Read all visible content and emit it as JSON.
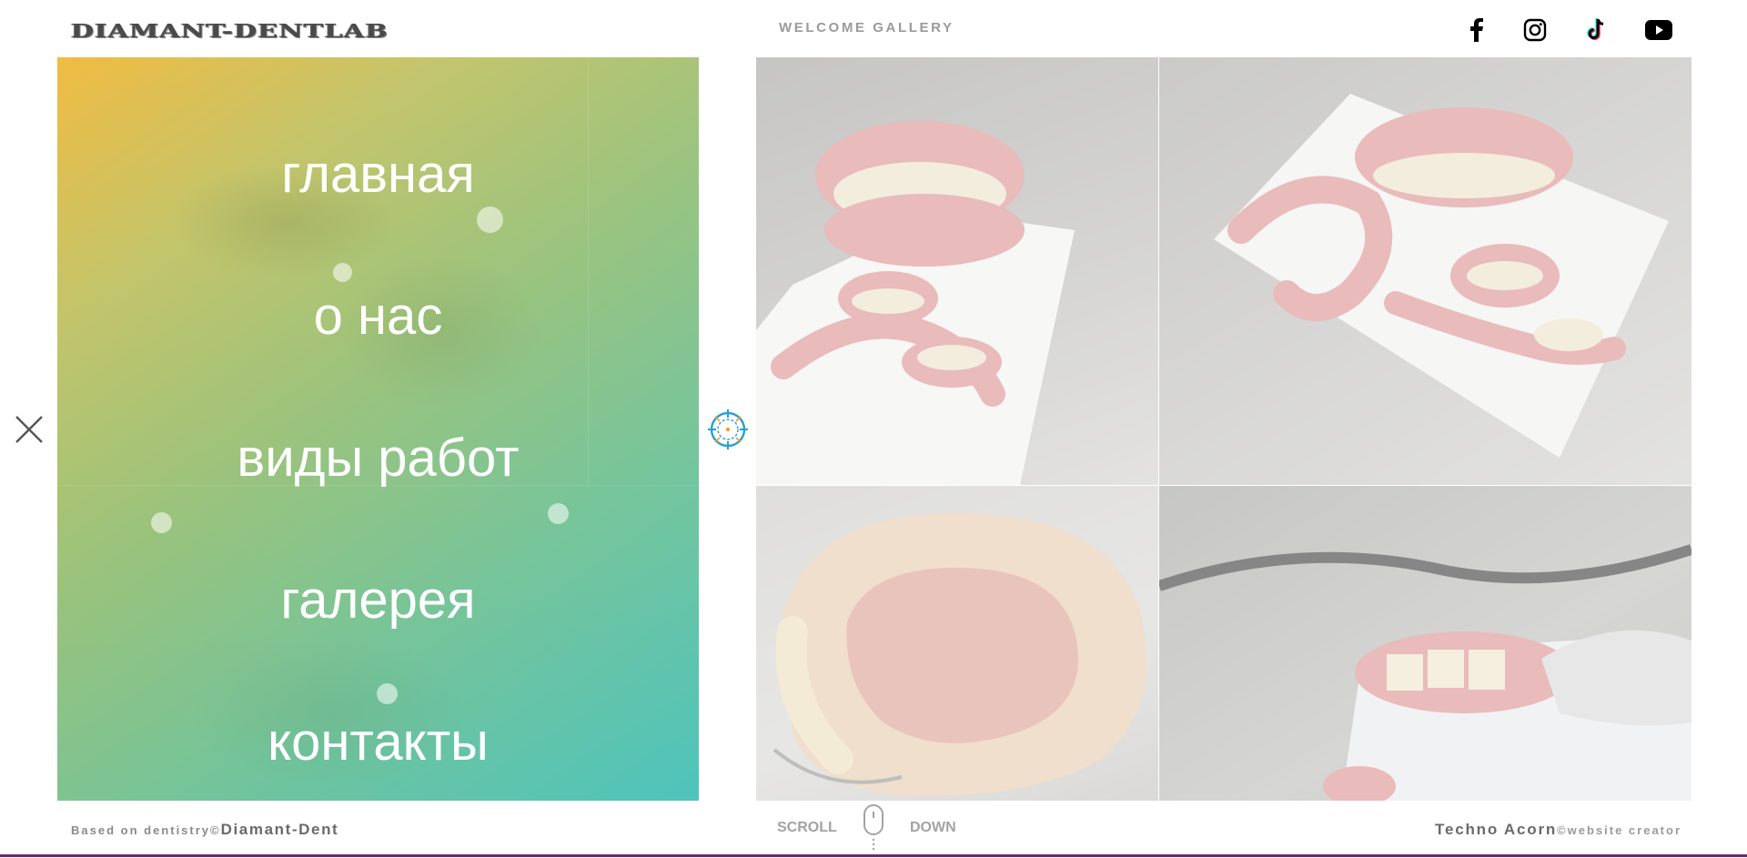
{
  "header": {
    "logo_text": "DIAMANT-DENTLAB",
    "welcome_text": "WELCOME GALLERY",
    "social_icons": [
      "facebook-icon",
      "instagram-icon",
      "tiktok-icon",
      "youtube-icon"
    ]
  },
  "menu": {
    "items": [
      {
        "label": "главная"
      },
      {
        "label": "о нас"
      },
      {
        "label": "виды работ"
      },
      {
        "label": "галерея"
      },
      {
        "label": "контакты"
      }
    ],
    "close_icon": "close-icon"
  },
  "gallery": {
    "tiles": [
      "denture-photo",
      "denture-photo",
      "denture-photo",
      "denture-photo"
    ]
  },
  "footer": {
    "left_prefix": "Based on dentistry©",
    "left_brand": "Diamant-Dent",
    "scroll_left": "SCROLL",
    "scroll_right": "DOWN",
    "right_brand": "Techno Acorn",
    "right_suffix": "©website creator"
  },
  "colors": {
    "gradient_start": "#f0b93b",
    "gradient_end": "#4ec4bc",
    "target_blue": "#2a9fd6",
    "target_orange": "#f0a030"
  }
}
